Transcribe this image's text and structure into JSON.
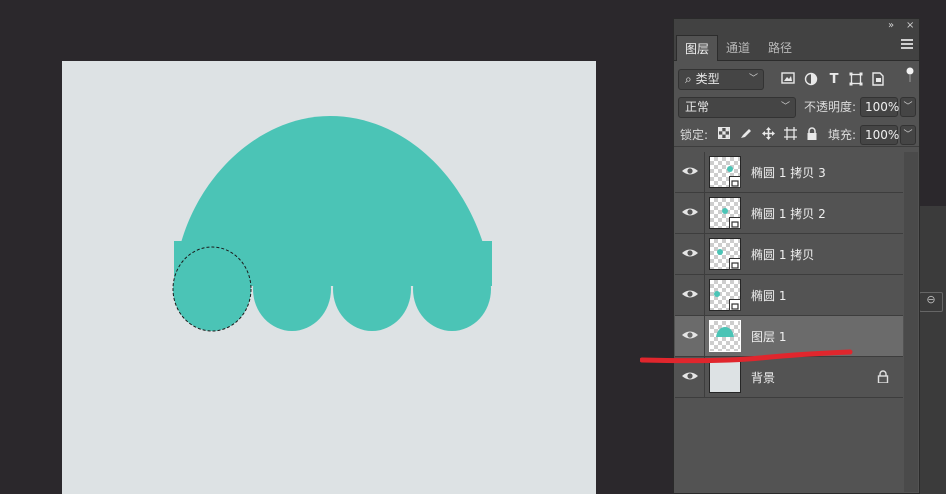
{
  "document": {
    "canvas_color": "#dde2e4",
    "shape_color": "#4bc4b6",
    "selection": "ellipse marquee"
  },
  "panel": {
    "collapse_glyph": "»",
    "close_glyph": "×",
    "tabs": [
      {
        "label": "图层",
        "active": true
      },
      {
        "label": "通道",
        "active": false
      },
      {
        "label": "路径",
        "active": false
      }
    ],
    "filter": {
      "search_glyph": "⌕",
      "kind_label": "类型",
      "icons": [
        "image-filter-icon",
        "adjustment-filter-icon",
        "type-filter-icon",
        "shape-filter-icon",
        "smart-object-filter-icon"
      ]
    },
    "blend_mode": "正常",
    "opacity_label": "不透明度:",
    "opacity_value": "100%",
    "lock_label": "锁定:",
    "fill_label": "填充:",
    "fill_value": "100%",
    "layers": [
      {
        "name": "椭圆 1 拷贝 3",
        "selected": false,
        "thumb": "checker",
        "smart": true,
        "locked": false
      },
      {
        "name": "椭圆 1 拷贝 2",
        "selected": false,
        "thumb": "checker",
        "smart": true,
        "locked": false
      },
      {
        "name": "椭圆 1 拷贝",
        "selected": false,
        "thumb": "checker",
        "smart": true,
        "locked": false
      },
      {
        "name": "椭圆 1",
        "selected": false,
        "thumb": "checker",
        "smart": true,
        "locked": false
      },
      {
        "name": "图层 1",
        "selected": true,
        "thumb": "checker",
        "smart": false,
        "locked": false
      },
      {
        "name": "背景",
        "selected": false,
        "thumb": "plain",
        "smart": false,
        "locked": true
      }
    ]
  },
  "annotation": {
    "color": "#e0262d"
  }
}
